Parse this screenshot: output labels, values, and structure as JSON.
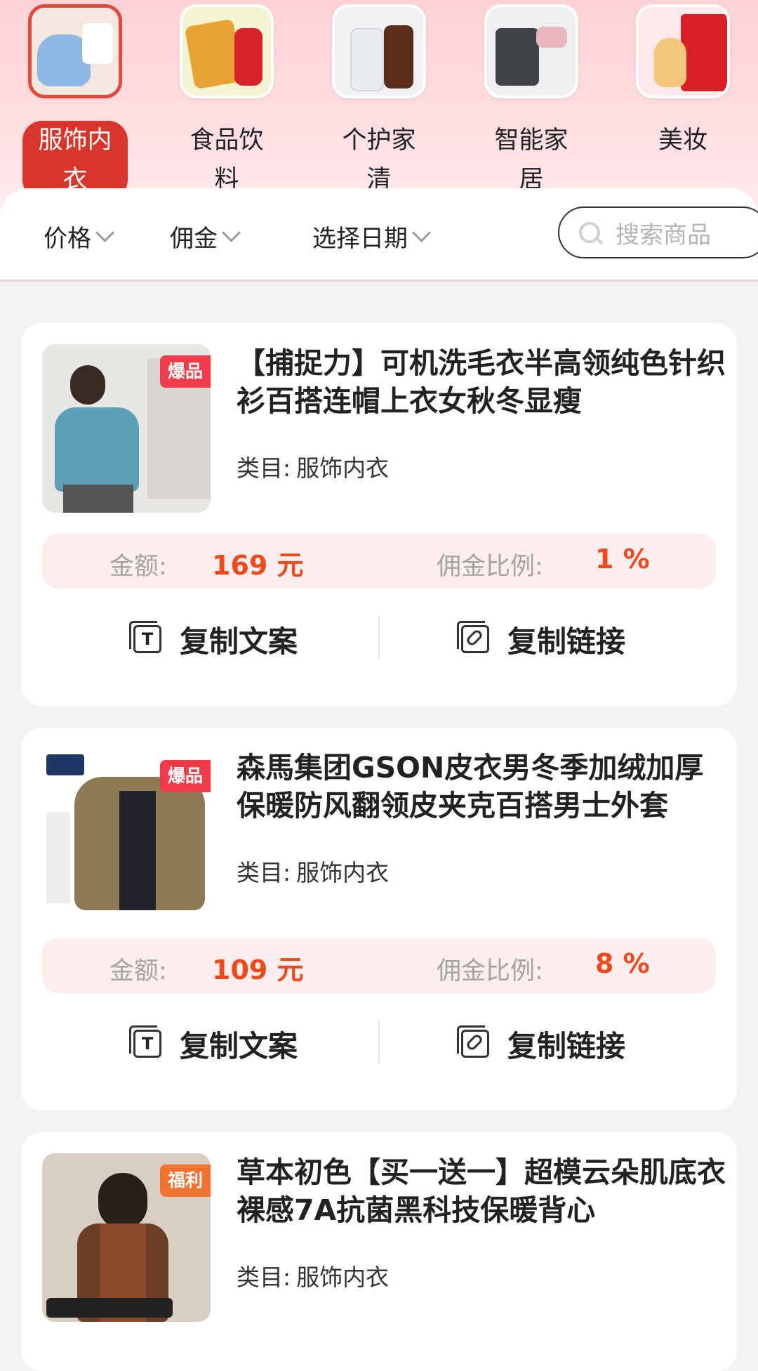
{
  "categories": [
    {
      "label": "服饰内衣",
      "active": true,
      "icon": "clothing-icon"
    },
    {
      "label": "食品饮料",
      "active": false,
      "icon": "snack-drink-icon"
    },
    {
      "label": "个护家清",
      "active": false,
      "icon": "bottle-icon"
    },
    {
      "label": "智能家居",
      "active": false,
      "icon": "robot-vacuum-icon"
    },
    {
      "label": "美妆",
      "active": false,
      "icon": "perfume-icon"
    }
  ],
  "filters": {
    "price": "价格",
    "commission": "佣金",
    "date": "选择日期",
    "search_placeholder": "搜索商品"
  },
  "labels": {
    "category_prefix": "类目:",
    "amount": "金额:",
    "commission_rate": "佣金比例:",
    "copy_text": "复制文案",
    "copy_link": "复制链接",
    "copy_text_icon_char": "T"
  },
  "products": [
    {
      "title": "【捕捉力】可机洗毛衣半高领纯色针织衫百搭连帽上衣女秋冬显瘦",
      "category": "服饰内衣",
      "badge": "爆品",
      "amount": "169 元",
      "rate": "1 %"
    },
    {
      "title": "森馬集团GSON皮衣男冬季加绒加厚保暖防风翻领皮夹克百搭男士外套",
      "category": "服饰内衣",
      "badge": "爆品",
      "amount": "109 元",
      "rate": "8 %"
    },
    {
      "title": "草本初色【买一送一】超模云朵肌底衣裸感7A抗菌黑科技保暖背心",
      "category": "服饰内衣",
      "badge": "福利"
    }
  ],
  "colors": {
    "accent": "#d9352a",
    "price": "#ef4a1d",
    "badge_hot": "#ef3b4a",
    "badge_welfare": "#f27331"
  }
}
